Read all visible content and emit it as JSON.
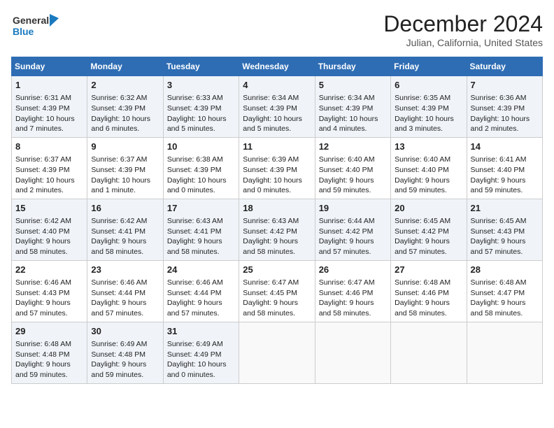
{
  "header": {
    "logo_line1": "General",
    "logo_line2": "Blue",
    "title": "December 2024",
    "subtitle": "Julian, California, United States"
  },
  "days_of_week": [
    "Sunday",
    "Monday",
    "Tuesday",
    "Wednesday",
    "Thursday",
    "Friday",
    "Saturday"
  ],
  "weeks": [
    [
      {
        "day": 1,
        "sunrise": "6:31 AM",
        "sunset": "4:39 PM",
        "daylight": "10 hours and 7 minutes."
      },
      {
        "day": 2,
        "sunrise": "6:32 AM",
        "sunset": "4:39 PM",
        "daylight": "10 hours and 6 minutes."
      },
      {
        "day": 3,
        "sunrise": "6:33 AM",
        "sunset": "4:39 PM",
        "daylight": "10 hours and 5 minutes."
      },
      {
        "day": 4,
        "sunrise": "6:34 AM",
        "sunset": "4:39 PM",
        "daylight": "10 hours and 5 minutes."
      },
      {
        "day": 5,
        "sunrise": "6:34 AM",
        "sunset": "4:39 PM",
        "daylight": "10 hours and 4 minutes."
      },
      {
        "day": 6,
        "sunrise": "6:35 AM",
        "sunset": "4:39 PM",
        "daylight": "10 hours and 3 minutes."
      },
      {
        "day": 7,
        "sunrise": "6:36 AM",
        "sunset": "4:39 PM",
        "daylight": "10 hours and 2 minutes."
      }
    ],
    [
      {
        "day": 8,
        "sunrise": "6:37 AM",
        "sunset": "4:39 PM",
        "daylight": "10 hours and 2 minutes."
      },
      {
        "day": 9,
        "sunrise": "6:37 AM",
        "sunset": "4:39 PM",
        "daylight": "10 hours and 1 minute."
      },
      {
        "day": 10,
        "sunrise": "6:38 AM",
        "sunset": "4:39 PM",
        "daylight": "10 hours and 0 minutes."
      },
      {
        "day": 11,
        "sunrise": "6:39 AM",
        "sunset": "4:39 PM",
        "daylight": "10 hours and 0 minutes."
      },
      {
        "day": 12,
        "sunrise": "6:40 AM",
        "sunset": "4:40 PM",
        "daylight": "9 hours and 59 minutes."
      },
      {
        "day": 13,
        "sunrise": "6:40 AM",
        "sunset": "4:40 PM",
        "daylight": "9 hours and 59 minutes."
      },
      {
        "day": 14,
        "sunrise": "6:41 AM",
        "sunset": "4:40 PM",
        "daylight": "9 hours and 59 minutes."
      }
    ],
    [
      {
        "day": 15,
        "sunrise": "6:42 AM",
        "sunset": "4:40 PM",
        "daylight": "9 hours and 58 minutes."
      },
      {
        "day": 16,
        "sunrise": "6:42 AM",
        "sunset": "4:41 PM",
        "daylight": "9 hours and 58 minutes."
      },
      {
        "day": 17,
        "sunrise": "6:43 AM",
        "sunset": "4:41 PM",
        "daylight": "9 hours and 58 minutes."
      },
      {
        "day": 18,
        "sunrise": "6:43 AM",
        "sunset": "4:42 PM",
        "daylight": "9 hours and 58 minutes."
      },
      {
        "day": 19,
        "sunrise": "6:44 AM",
        "sunset": "4:42 PM",
        "daylight": "9 hours and 57 minutes."
      },
      {
        "day": 20,
        "sunrise": "6:45 AM",
        "sunset": "4:42 PM",
        "daylight": "9 hours and 57 minutes."
      },
      {
        "day": 21,
        "sunrise": "6:45 AM",
        "sunset": "4:43 PM",
        "daylight": "9 hours and 57 minutes."
      }
    ],
    [
      {
        "day": 22,
        "sunrise": "6:46 AM",
        "sunset": "4:43 PM",
        "daylight": "9 hours and 57 minutes."
      },
      {
        "day": 23,
        "sunrise": "6:46 AM",
        "sunset": "4:44 PM",
        "daylight": "9 hours and 57 minutes."
      },
      {
        "day": 24,
        "sunrise": "6:46 AM",
        "sunset": "4:44 PM",
        "daylight": "9 hours and 57 minutes."
      },
      {
        "day": 25,
        "sunrise": "6:47 AM",
        "sunset": "4:45 PM",
        "daylight": "9 hours and 58 minutes."
      },
      {
        "day": 26,
        "sunrise": "6:47 AM",
        "sunset": "4:46 PM",
        "daylight": "9 hours and 58 minutes."
      },
      {
        "day": 27,
        "sunrise": "6:48 AM",
        "sunset": "4:46 PM",
        "daylight": "9 hours and 58 minutes."
      },
      {
        "day": 28,
        "sunrise": "6:48 AM",
        "sunset": "4:47 PM",
        "daylight": "9 hours and 58 minutes."
      }
    ],
    [
      {
        "day": 29,
        "sunrise": "6:48 AM",
        "sunset": "4:48 PM",
        "daylight": "9 hours and 59 minutes."
      },
      {
        "day": 30,
        "sunrise": "6:49 AM",
        "sunset": "4:48 PM",
        "daylight": "9 hours and 59 minutes."
      },
      {
        "day": 31,
        "sunrise": "6:49 AM",
        "sunset": "4:49 PM",
        "daylight": "10 hours and 0 minutes."
      },
      null,
      null,
      null,
      null
    ]
  ]
}
